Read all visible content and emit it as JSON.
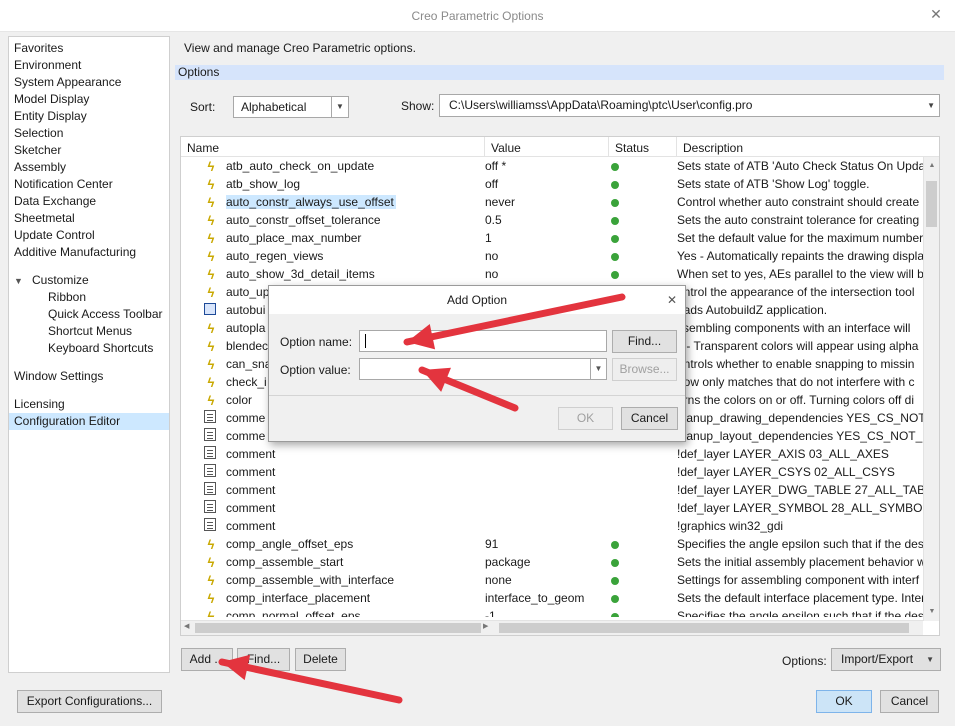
{
  "window": {
    "title": "Creo Parametric Options"
  },
  "nav": {
    "items": [
      {
        "label": "Favorites"
      },
      {
        "label": "Environment"
      },
      {
        "label": "System Appearance"
      },
      {
        "label": "Model Display"
      },
      {
        "label": "Entity Display"
      },
      {
        "label": "Selection"
      },
      {
        "label": "Sketcher"
      },
      {
        "label": "Assembly"
      },
      {
        "label": "Notification Center"
      },
      {
        "label": "Data Exchange"
      },
      {
        "label": "Sheetmetal"
      },
      {
        "label": "Update Control"
      },
      {
        "label": "Additive Manufacturing"
      }
    ],
    "customize": {
      "label": "Customize",
      "children": [
        "Ribbon",
        "Quick Access Toolbar",
        "Shortcut Menus",
        "Keyboard Shortcuts"
      ]
    },
    "window_settings": "Window Settings",
    "licensing": "Licensing",
    "config_editor": "Configuration Editor"
  },
  "main": {
    "description": "View and manage Creo Parametric options.",
    "section_title": "Options",
    "sort_label": "Sort:",
    "sort_value": "Alphabetical",
    "show_label": "Show:",
    "show_value": "C:\\Users\\williamss\\AppData\\Roaming\\ptc\\User\\config.pro"
  },
  "table": {
    "headers": {
      "name": "Name",
      "value": "Value",
      "status": "Status",
      "description": "Description"
    },
    "rows": [
      {
        "icon": "bolt",
        "name": "atb_auto_check_on_update",
        "value": "off *",
        "status": true,
        "description": "Sets state of ATB 'Auto Check Status On Update'"
      },
      {
        "icon": "bolt",
        "name": "atb_show_log",
        "value": "off",
        "status": true,
        "description": "Sets state of ATB 'Show Log' toggle."
      },
      {
        "icon": "bolt",
        "name": "auto_constr_always_use_offset",
        "value": "never",
        "status": true,
        "description": "Control whether auto constraint should create"
      },
      {
        "icon": "bolt",
        "name": "auto_constr_offset_tolerance",
        "value": "0.5",
        "status": true,
        "description": "Sets the auto constraint tolerance for creating c"
      },
      {
        "icon": "bolt",
        "name": "auto_place_max_number",
        "value": "1",
        "status": true,
        "description": "Set the default value for the maximum number"
      },
      {
        "icon": "bolt",
        "name": "auto_regen_views",
        "value": "no",
        "status": true,
        "description": "Yes - Automatically repaints the drawing displa"
      },
      {
        "icon": "bolt",
        "name": "auto_show_3d_detail_items",
        "value": "no",
        "status": true,
        "description": "When set to yes, AEs parallel to the view will be"
      },
      {
        "icon": "bolt",
        "name": "auto_up",
        "value": "",
        "status": false,
        "description": "ontrol the appearance of the intersection tool"
      },
      {
        "icon": "app",
        "name": "autobui",
        "value": "",
        "status": false,
        "description": "oads AutobuildZ application."
      },
      {
        "icon": "bolt",
        "name": "autopla",
        "value": "",
        "status": false,
        "description": "ssembling components with an interface will"
      },
      {
        "icon": "bolt",
        "name": "blendec",
        "value": "",
        "status": false,
        "description": "s - Transparent colors will appear using alpha"
      },
      {
        "icon": "bolt",
        "name": "can_sna",
        "value": "",
        "status": false,
        "description": "ontrols whether to enable snapping to missin"
      },
      {
        "icon": "bolt",
        "name": "check_i",
        "value": "",
        "status": false,
        "description": "how only matches that do not interfere with c"
      },
      {
        "icon": "bolt",
        "name": "color",
        "value": "",
        "status": false,
        "description": "urns the colors on or off. Turning colors off di"
      },
      {
        "icon": "comment",
        "name": "comme",
        "value": "",
        "status": false,
        "description": "leanup_drawing_dependencies YES_CS_NOT_"
      },
      {
        "icon": "comment",
        "name": "comme",
        "value": "",
        "status": false,
        "description": "leanup_layout_dependencies YES_CS_NOT_RE"
      },
      {
        "icon": "comment",
        "name": "comment",
        "value": "",
        "status": false,
        "description": "!def_layer LAYER_AXIS 03_ALL_AXES"
      },
      {
        "icon": "comment",
        "name": "comment",
        "value": "",
        "status": false,
        "description": "!def_layer LAYER_CSYS 02_ALL_CSYS"
      },
      {
        "icon": "comment",
        "name": "comment",
        "value": "",
        "status": false,
        "description": "!def_layer LAYER_DWG_TABLE 27_ALL_TABLES"
      },
      {
        "icon": "comment",
        "name": "comment",
        "value": "",
        "status": false,
        "description": "!def_layer LAYER_SYMBOL 28_ALL_SYMBOLS"
      },
      {
        "icon": "comment",
        "name": "comment",
        "value": "",
        "status": false,
        "description": "!graphics win32_gdi"
      },
      {
        "icon": "bolt",
        "name": "comp_angle_offset_eps",
        "value": "91",
        "status": true,
        "description": "Specifies the angle epsilon such that if the desi"
      },
      {
        "icon": "bolt",
        "name": "comp_assemble_start",
        "value": "package",
        "status": true,
        "description": "Sets the initial assembly placement behavior w"
      },
      {
        "icon": "bolt",
        "name": "comp_assemble_with_interface",
        "value": "none",
        "status": true,
        "description": "Settings for assembling component with interf"
      },
      {
        "icon": "bolt",
        "name": "comp_interface_placement",
        "value": "interface_to_geom",
        "status": true,
        "description": "Sets the default interface placement type. Inter"
      },
      {
        "icon": "bolt",
        "name": "comp_normal_offset_eps",
        "value": "-1",
        "status": true,
        "description": "Specifies the angle epsilon such that if the desi"
      }
    ]
  },
  "bottom": {
    "add": "Add ...",
    "find": "Find...",
    "delete": "Delete",
    "options_label": "Options:",
    "options_value": "Import/Export",
    "export": "Export Configurations...",
    "ok": "OK",
    "cancel": "Cancel"
  },
  "dialog": {
    "title": "Add Option",
    "option_name_label": "Option name:",
    "option_value_label": "Option value:",
    "find": "Find...",
    "browse": "Browse...",
    "ok": "OK",
    "cancel": "Cancel"
  },
  "colors": {
    "accent": "#cde8ff",
    "arrow": "#e3343e",
    "status_ok": "#3aa33a"
  }
}
